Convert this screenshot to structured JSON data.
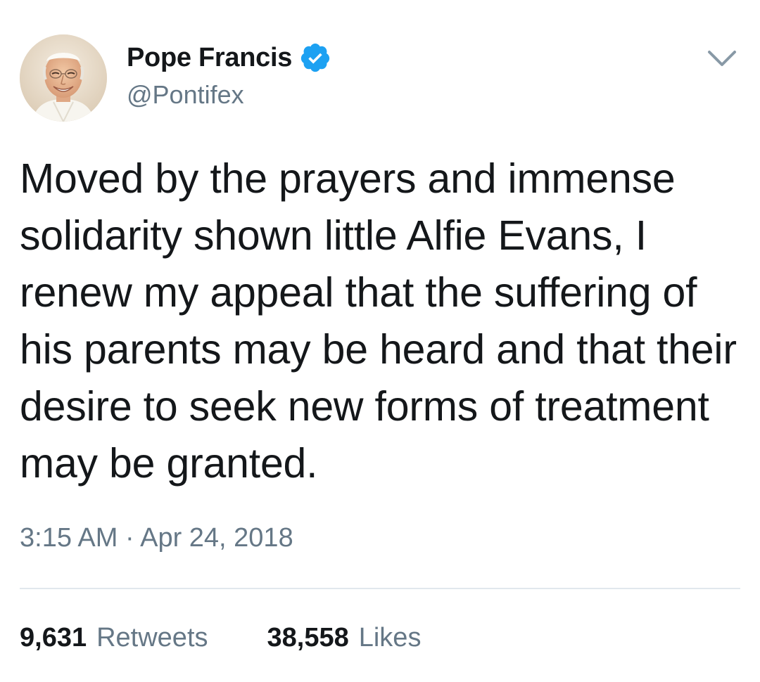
{
  "author": {
    "display_name": "Pope Francis",
    "handle": "@Pontifex",
    "verified": true
  },
  "icons": {
    "verified": "verified-badge-icon",
    "menu": "chevron-down-icon"
  },
  "tweet": {
    "text": "Moved by the prayers and immense solidarity shown little Alfie Evans, I renew my appeal that the suffering of his parents may be heard and that their desire to seek new forms of treatment may be granted.",
    "timestamp": "3:15 AM · Apr 24, 2018"
  },
  "stats": {
    "retweets_count": "9,631",
    "retweets_label": "Retweets",
    "likes_count": "38,558",
    "likes_label": "Likes"
  },
  "colors": {
    "verified_blue": "#1da1f2",
    "secondary_text": "#657786",
    "primary_text": "#14171a",
    "divider": "#e1e8ed"
  }
}
